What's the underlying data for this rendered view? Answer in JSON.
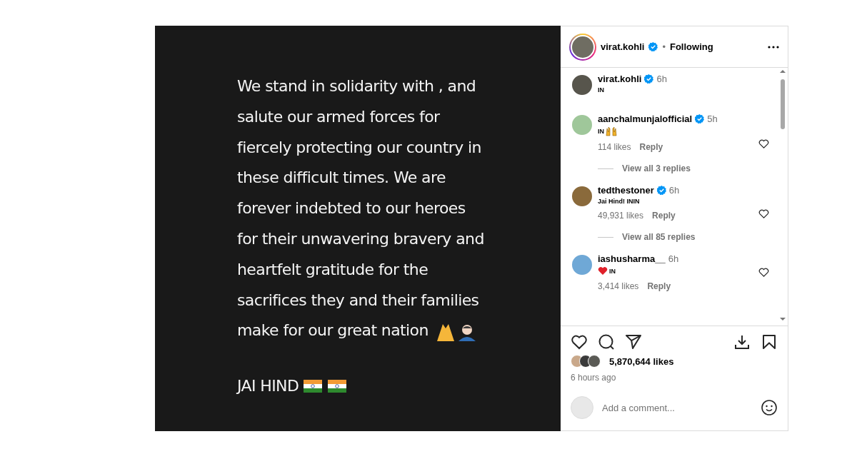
{
  "post": {
    "kind": "picture-text",
    "lines": [
      "We stand in solidarity with , and",
      "salute our armed forces for",
      "fiercely protecting our country in",
      "these difficult times. We are",
      "forever indebted to our heroes",
      "for their unwavering bravery and",
      "heartfelt gratitude for the",
      "sacrifices they and their families",
      "make for our great nation"
    ],
    "closing": "JAI HIND"
  },
  "header": {
    "username": "virat.kohli",
    "verified": true,
    "separator": "•",
    "follow_label": "Following"
  },
  "comments": [
    {
      "kind": "plain",
      "username": "virat.kohli",
      "verified": true,
      "time": "6h",
      "text": "IN",
      "likeable": false
    },
    {
      "kind": "hands",
      "username": "aanchalmunjalofficial",
      "verified": true,
      "time": "5h",
      "text": "IN",
      "likes": "114 likes",
      "reply": "Reply",
      "view_replies": "View all 3 replies",
      "likeable": true
    },
    {
      "kind": "plain",
      "username": "tedthestoner",
      "verified": true,
      "time": "6h",
      "text": "Jai Hind! ININ",
      "likes": "49,931 likes",
      "reply": "Reply",
      "view_replies": "View all 85 replies",
      "likeable": true
    },
    {
      "kind": "heart",
      "username": "iashusharma__",
      "verified": false,
      "time": "6h",
      "text": "IN",
      "likes": "3,414 likes",
      "reply": "Reply",
      "likeable": true
    }
  ],
  "likes": "5,870,644 likes",
  "posted": "6 hours ago",
  "comment_field": {
    "placeholder": "Add a comment..."
  }
}
